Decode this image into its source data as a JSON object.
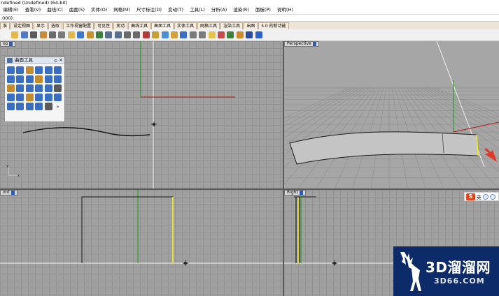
{
  "window": {
    "title": "ndefined (Undefined) (64-bit)"
  },
  "menu": [
    "编辑(E)",
    "查看(V)",
    "曲线(C)",
    "曲面(S)",
    "实体(O)",
    "网格(M)",
    "尺寸标注(D)",
    "变动(T)",
    "工具(L)",
    "分析(A)",
    "渲染(R)",
    "面板(P)",
    "说明(H)"
  ],
  "command_line": {
    "text": ".000):"
  },
  "tabs": [
    "准",
    "设定视图",
    "显示",
    "选取",
    "工作视窗配置",
    "可见性",
    "变动",
    "曲线工具",
    "曲面工具",
    "实体工具",
    "网格工具",
    "渲染工具",
    "出图",
    "5.0 的新功能"
  ],
  "toolbar_icons": [
    "new-icon",
    "open-icon",
    "save-icon",
    "print-icon",
    "import-icon",
    "cut-icon",
    "copy-icon",
    "paste-icon",
    "undo-icon",
    "pan-icon",
    "rotate-view-icon",
    "zoom-icon",
    "zoom-extents-icon",
    "zoom-window-icon",
    "zoom-selected-icon",
    "hide-icon",
    "lock-icon",
    "layer-icon",
    "properties-icon",
    "select-all-icon",
    "points-on-icon",
    "points-off-icon",
    "light-icon",
    "material-icon",
    "osnap-icon",
    "render-icon",
    "sphere-icon",
    "help-icon"
  ],
  "toolbar_colors": [
    "#f3f3f3",
    "#e6b74a",
    "#4d79c7",
    "#5b5b5b",
    "#c98b3b",
    "#6b6b6b",
    "#7a7a7a",
    "#e0b84f",
    "#3e78c9",
    "#c4932f",
    "#3e7f3e",
    "#5a6e90",
    "#5a6e90",
    "#6a6a6a",
    "#6a6a6a",
    "#b13a3a",
    "#c8a036",
    "#4b8fd2",
    "#d4a23c",
    "#3c6fbf",
    "#7b7b7b",
    "#7b7b7b",
    "#e6c34a",
    "#c84b4b",
    "#3f7f3f",
    "#cf8a2e",
    "#2b4c9a",
    "#2d63c8"
  ],
  "floating_panel": {
    "title": "曲面工具",
    "icons": [
      "surface-fillet-icon",
      "surface-offset-icon",
      "variable-fillet-icon",
      "blend-surface-icon",
      "extend-surface-icon",
      "match-surface-icon",
      "merge-surface-icon",
      "rebuild-surface-icon",
      "fit-surface-icon",
      "unroll-icon",
      "split-surface-icon",
      "trim-surface-icon",
      "patch-icon",
      "network-surface-icon",
      "edge-curves-icon",
      "shrink-surface-icon",
      "refit-icon",
      "uv-curves-icon",
      "sweep-icon",
      "loft-icon",
      "revolve-icon",
      "rail-revolve-icon",
      "extrude-icon",
      "plane-icon",
      "cage-edit-icon",
      "flow-along-icon",
      "twist-icon",
      "bend-icon",
      "taper-icon",
      "more-icon"
    ],
    "icon_colors": [
      "#3a6ec0",
      "#3a6ec0",
      "#c48a2e",
      "#3a6ec0",
      "#3a6ec0",
      "#3a6ec0",
      "#3a6ec0",
      "#3a6ec0",
      "#3a6ec0",
      "#c48a2e",
      "#3a6ec0",
      "#3a6ec0",
      "#c48a2e",
      "#3a6ec0",
      "#3a6ec0",
      "#3a6ec0",
      "#3a6ec0",
      "#5a5a5a",
      "#3a6ec0",
      "#3a6ec0",
      "#c48a2e",
      "#3a6ec0",
      "#3a6ec0",
      "#3a6ec0",
      "#3a6ec0",
      "#3a6ec0",
      "#3a6ec0",
      "#3a6ec0",
      "#5a5a5a",
      "#5a5a5a"
    ]
  },
  "viewports": {
    "top": {
      "label": "op"
    },
    "perspective": {
      "label": "Perspective"
    },
    "front": {
      "label": "ont"
    },
    "right": {
      "label": "Right"
    }
  },
  "axis_labels": {
    "y": "y",
    "x": "x"
  },
  "widget": {
    "logo": "S",
    "text": "英"
  },
  "watermark": {
    "brand": "3D溜溜网",
    "site": "3D66.COM"
  },
  "colors": {
    "viewport_bg": "#a0a0a0",
    "grid_line": "#939393",
    "x_axis": "#b01616",
    "y_axis": "#179a17",
    "selection": "#e7e72a",
    "tabs_bg": "#eee3d7",
    "watermark_bg": "#0c2b68",
    "arrow": "#e23a2a"
  }
}
